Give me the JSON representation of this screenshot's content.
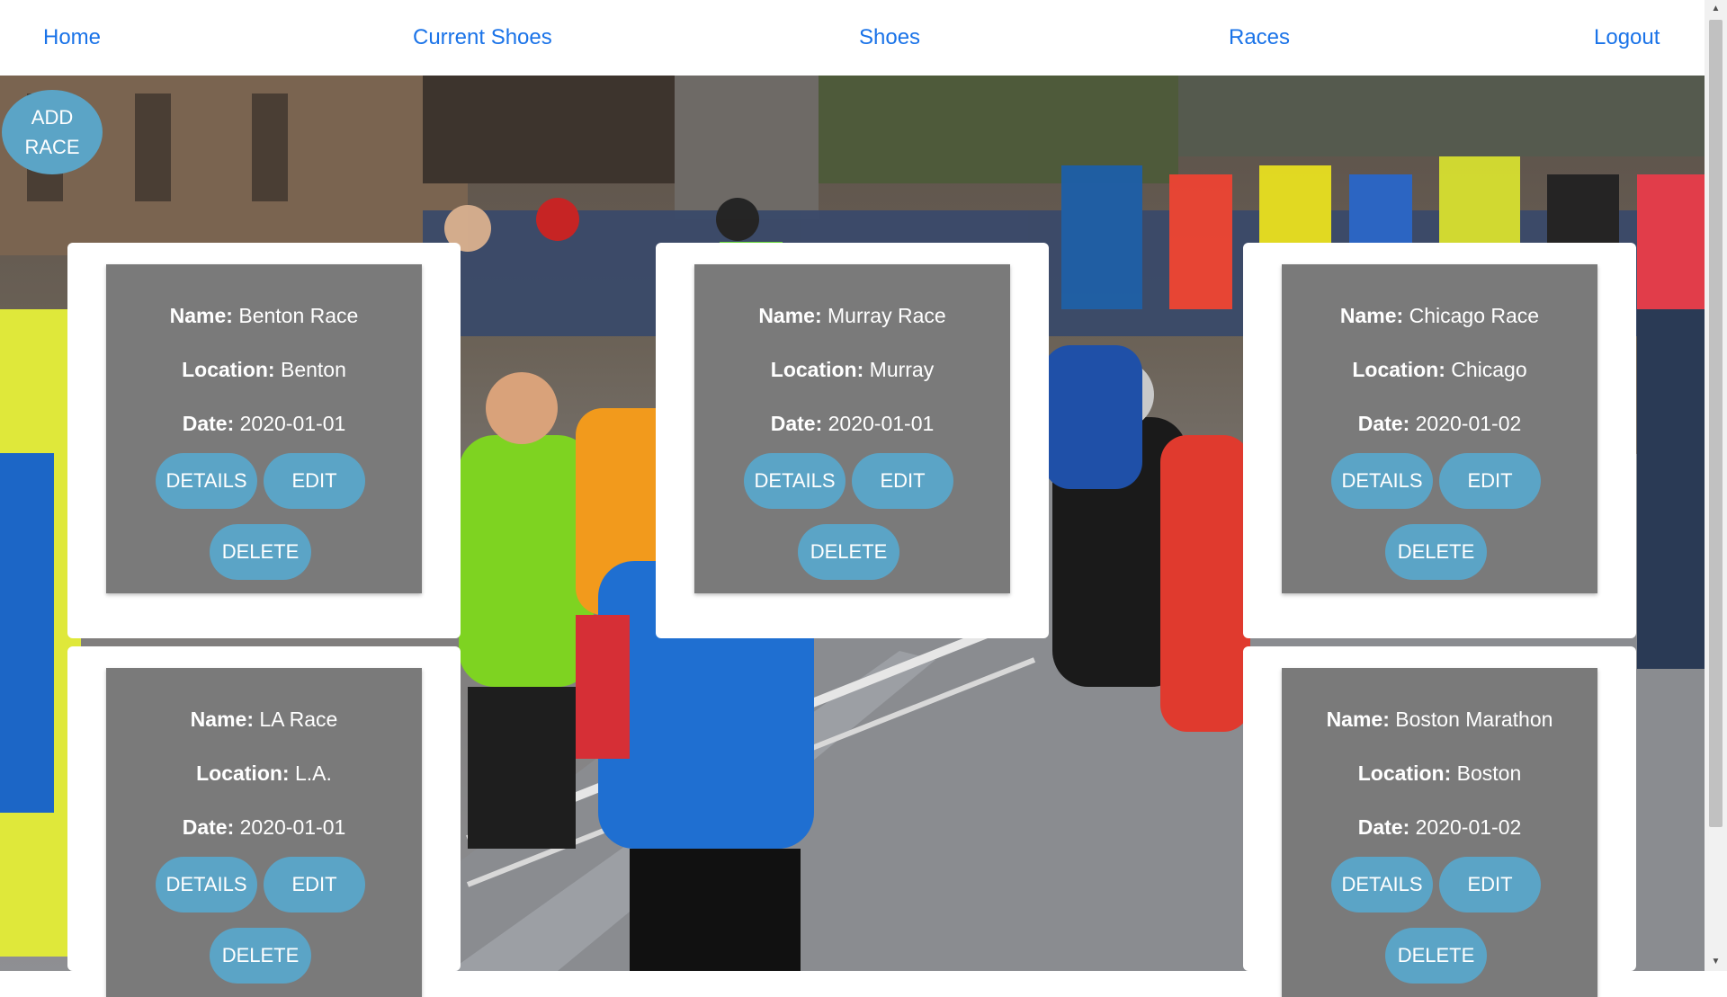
{
  "nav": {
    "home": "Home",
    "current_shoes": "Current Shoes",
    "shoes": "Shoes",
    "races": "Races",
    "logout": "Logout"
  },
  "add_race_label": "ADD\nRACE",
  "labels": {
    "name": "Name:",
    "location": "Location:",
    "date": "Date:",
    "details": "DETAILS",
    "edit": "EDIT",
    "delete": "DELETE"
  },
  "races": [
    {
      "name": "Benton Race",
      "location": "Benton",
      "date": "2020-01-01"
    },
    {
      "name": "Murray Race",
      "location": "Murray",
      "date": "2020-01-01"
    },
    {
      "name": "Chicago Race",
      "location": "Chicago",
      "date": "2020-01-02"
    },
    {
      "name": "LA Race",
      "location": "L.A.",
      "date": "2020-01-01"
    },
    {
      "name": "Boston Marathon",
      "location": "Boston",
      "date": "2020-01-02"
    }
  ],
  "colors": {
    "accent": "#5ba4c6",
    "nav_link": "#1a73e8",
    "card_inner": "#7a7a7a"
  },
  "background": "marathon-runners-photo"
}
